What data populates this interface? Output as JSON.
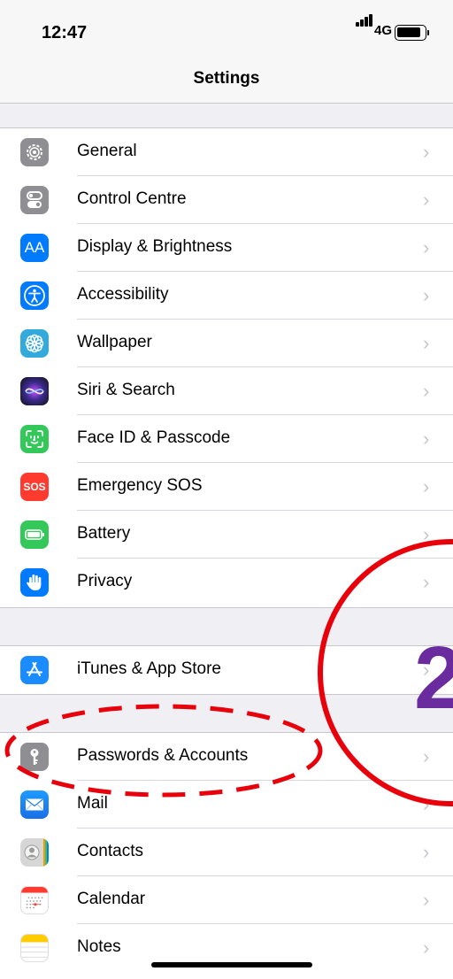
{
  "status": {
    "time": "12:47",
    "network": "4G"
  },
  "nav": {
    "title": "Settings"
  },
  "groups": [
    {
      "items": [
        {
          "label": "General",
          "icon": "gear-icon"
        },
        {
          "label": "Control Centre",
          "icon": "toggle-icon"
        },
        {
          "label": "Display & Brightness",
          "icon": "text-size-icon",
          "icon_text": "AA"
        },
        {
          "label": "Accessibility",
          "icon": "accessibility-icon"
        },
        {
          "label": "Wallpaper",
          "icon": "flower-icon"
        },
        {
          "label": "Siri & Search",
          "icon": "siri-icon"
        },
        {
          "label": "Face ID & Passcode",
          "icon": "face-id-icon"
        },
        {
          "label": "Emergency SOS",
          "icon": "sos-icon",
          "icon_text": "SOS"
        },
        {
          "label": "Battery",
          "icon": "battery-icon"
        },
        {
          "label": "Privacy",
          "icon": "hand-icon"
        }
      ]
    },
    {
      "items": [
        {
          "label": "iTunes & App Store",
          "icon": "app-store-icon"
        }
      ]
    },
    {
      "items": [
        {
          "label": "Passwords & Accounts",
          "icon": "key-icon"
        },
        {
          "label": "Mail",
          "icon": "mail-icon"
        },
        {
          "label": "Contacts",
          "icon": "contacts-icon"
        },
        {
          "label": "Calendar",
          "icon": "calendar-icon"
        },
        {
          "label": "Notes",
          "icon": "notes-icon"
        }
      ]
    }
  ],
  "annotation": {
    "step_number": "2"
  },
  "chevron": "›",
  "colors": {
    "annotation_red": "#e8000b",
    "step_purple": "#6a2b9e"
  }
}
